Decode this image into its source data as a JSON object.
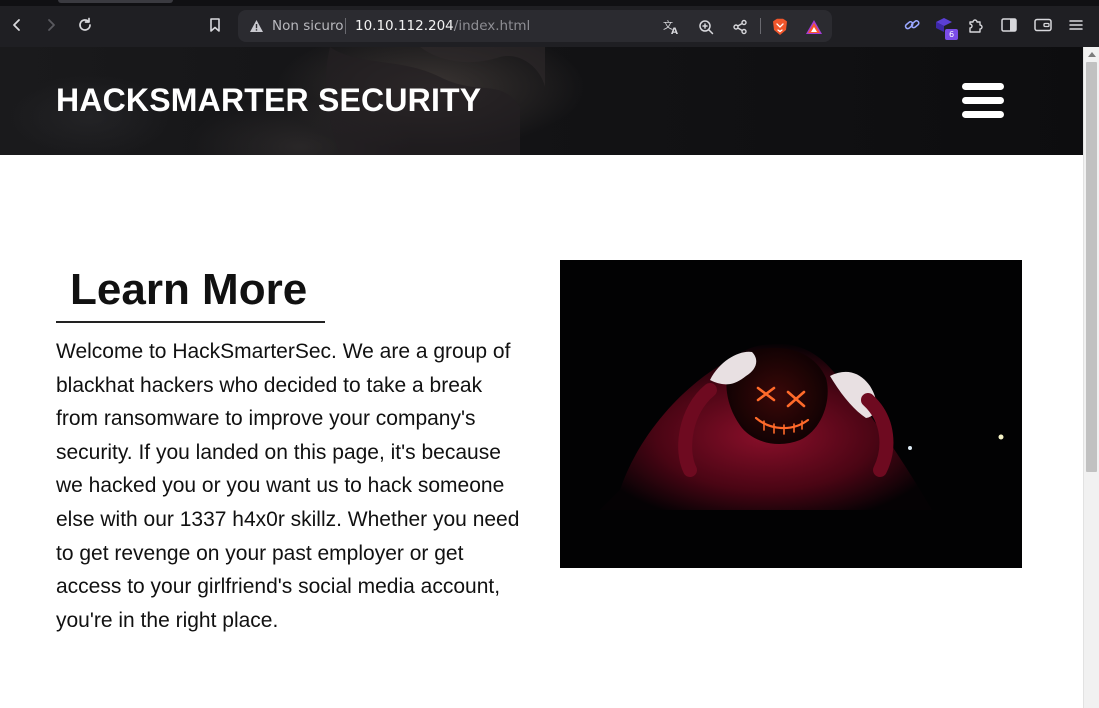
{
  "browser": {
    "security_label": "Non sicuro",
    "url_host": "10.10.112.204",
    "url_path": "/index.html",
    "extension_badge": "6",
    "colors": {
      "chrome": "#1f1f23",
      "urlbar": "#2b2b30",
      "badge": "#7b4ce8"
    },
    "icons": [
      "back-icon",
      "forward-icon",
      "reload-icon",
      "bookmark-icon",
      "warning-icon",
      "translate-icon",
      "zoom-icon",
      "share-icon",
      "brave-shield-icon",
      "brave-rewards-icon",
      "link-extension-icon",
      "puzzle-extension-icon",
      "extensions-icon",
      "sidebar-icon",
      "wallet-icon",
      "menu-icon"
    ]
  },
  "site": {
    "title": "HACKSMARTER SECURITY",
    "menu_icon": "hamburger-icon"
  },
  "learn_more": {
    "heading": "Learn More",
    "body": "Welcome to HackSmarterSec. We are a group of blackhat hackers who decided to take a break from ransomware to improve your company's security. If you landed on this page, it's because we hacked you or you want us to hack someone else with our 1337 h4x0r skillz. Whether you need to get revenge on your past employer or get access to your girlfriend's social media account, you're in the right place."
  }
}
